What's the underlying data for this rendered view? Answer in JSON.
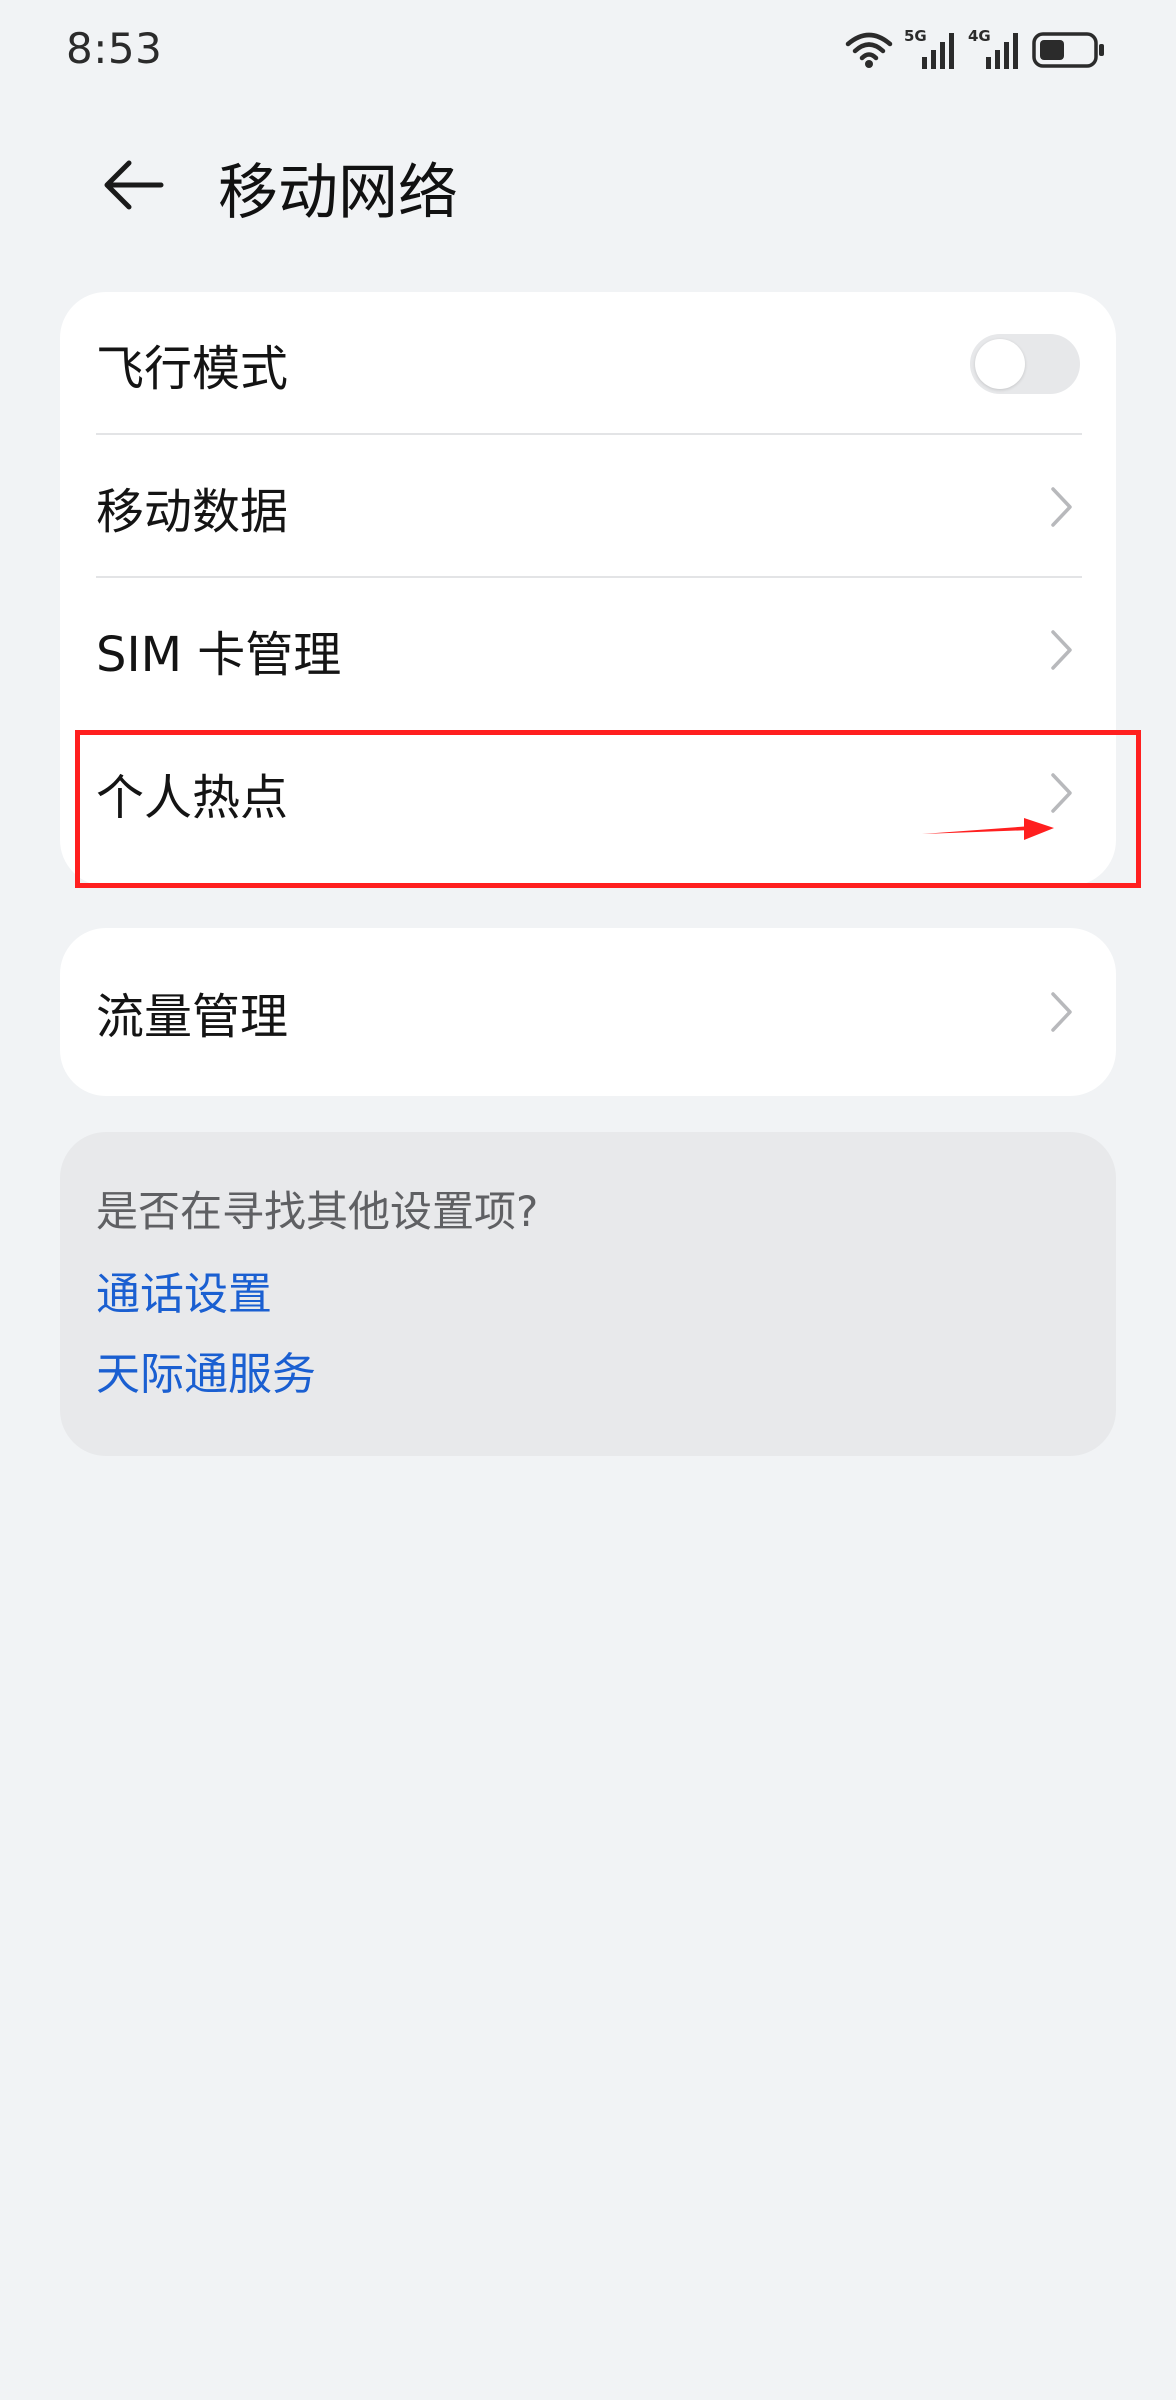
{
  "status_bar": {
    "time": "8:53",
    "icons": [
      "wifi-icon",
      "signal-5g-icon",
      "signal-4g-icon",
      "battery-icon"
    ],
    "network_labels": [
      "5G",
      "4G"
    ]
  },
  "header": {
    "title": "移动网络",
    "back_icon": "arrow-left-icon"
  },
  "settings_group_1": {
    "items": [
      {
        "label": "飞行模式",
        "control": "toggle",
        "toggle_on": false
      },
      {
        "label": "移动数据",
        "control": "chevron"
      },
      {
        "label": "SIM 卡管理",
        "control": "chevron"
      },
      {
        "label": "个人热点",
        "control": "chevron"
      }
    ]
  },
  "settings_group_2": {
    "items": [
      {
        "label": "流量管理",
        "control": "chevron"
      }
    ]
  },
  "suggestions": {
    "title": "是否在寻找其他设置项?",
    "links": [
      "通话设置",
      "天际通服务"
    ]
  },
  "colors": {
    "background": "#f1f3f5",
    "card": "#ffffff",
    "link": "#1a5fd1",
    "annotation": "#ff1f1f",
    "toggle_off": "#e7e8ea"
  }
}
